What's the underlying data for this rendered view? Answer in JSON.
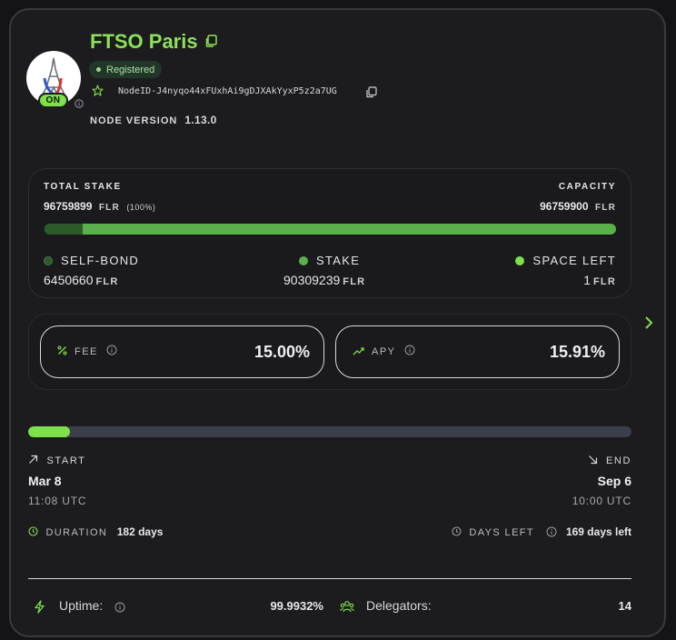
{
  "node": {
    "name": "FTSO Paris",
    "status_badge": "ON",
    "registered_label": "Registered",
    "node_id": "NodeID-J4nyqo44xFUxhAi9gDJXAkYyxP5z2a7UG",
    "version_label": "NODE VERSION",
    "version": "1.13.0"
  },
  "stake": {
    "total_label": "TOTAL STAKE",
    "total_value": "96759899",
    "total_unit": "FLR",
    "total_pct": "(100%)",
    "capacity_label": "CAPACITY",
    "capacity_value": "96759900",
    "capacity_unit": "FLR",
    "selfbond_fraction": 0.0667,
    "legend": {
      "selfbond_label": "SELF-BOND",
      "selfbond_value": "6450660",
      "stake_label": "STAKE",
      "stake_value": "90309239",
      "space_label": "SPACE LEFT",
      "space_value": "1",
      "unit": "FLR"
    }
  },
  "rates": {
    "fee_label": "FEE",
    "fee_value": "15.00%",
    "apy_label": "APY",
    "apy_value": "15.91%"
  },
  "timeline": {
    "progress_fraction": 0.07,
    "start_label": "START",
    "start_date": "Mar 8",
    "start_time": "11:08 UTC",
    "end_label": "END",
    "end_date": "Sep 6",
    "end_time": "10:00 UTC",
    "duration_label": "DURATION",
    "duration_value": "182 days",
    "days_left_label": "DAYS LEFT",
    "days_left_value": "169 days left"
  },
  "footer": {
    "uptime_label": "Uptime:",
    "uptime_value": "99.9932%",
    "delegators_label": "Delegators:",
    "delegators_value": "14"
  },
  "colors": {
    "accent": "#8de05a",
    "on_badge": "#7ee04a",
    "selfbond": "#2c5a2a",
    "stake": "#5ab04a",
    "space_left": "#7ee04a",
    "track": "#3a3f4a"
  },
  "icons": [
    "copy-icon",
    "star-icon",
    "info-icon",
    "percent-icon",
    "trend-up-icon",
    "chevron-right-icon",
    "arrow-up-right-icon",
    "arrow-down-right-icon",
    "clock-icon",
    "bolt-icon",
    "users-icon",
    "eiffel-tower-logo"
  ]
}
